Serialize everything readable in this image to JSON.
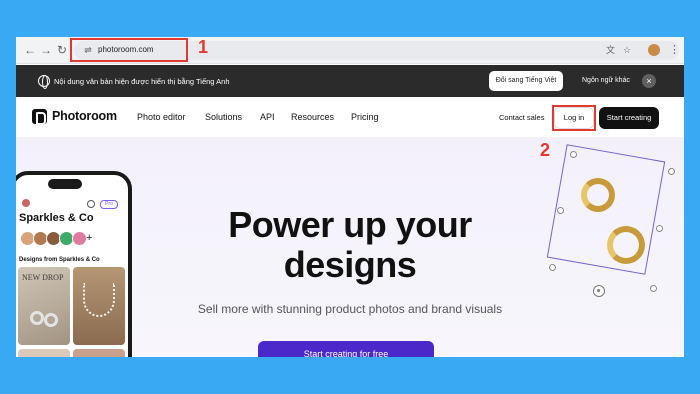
{
  "browser": {
    "url": "photoroom.com",
    "back_icon": "←",
    "forward_icon": "→",
    "reload_icon": "↻",
    "site_info_icon": "⇌",
    "translate_icon": "文",
    "bookmark_icon": "☆",
    "menu_icon": "⋮"
  },
  "translate_bar": {
    "message": "Nội dung văn bản hiện được hiển thị bằng Tiếng Anh",
    "switch_button": "Đổi sang Tiếng Việt",
    "other_languages": "Ngôn ngữ khác",
    "close_icon": "×"
  },
  "site_nav": {
    "logo": "Photoroom",
    "links": [
      "Photo editor",
      "Solutions",
      "API",
      "Resources",
      "Pricing"
    ],
    "contact_sales": "Contact sales",
    "log_in": "Log in",
    "start_creating": "Start creating"
  },
  "hero": {
    "title_line1": "Power up your",
    "title_line2": "designs",
    "subtitle": "Sell more with stunning product photos and brand visuals",
    "cta": "Start creating for free"
  },
  "phone": {
    "brand": "Sparkles & Co",
    "pro_badge": "Pro",
    "designs_label": "Designs from Sparkles & Co",
    "tile_text": "NEW DROP",
    "plus": "+"
  },
  "annotations": {
    "step1": "1",
    "step2": "2"
  },
  "colors": {
    "background": "#3aa9f3",
    "cta": "#4b28c9",
    "annotation_red": "#e0392f",
    "translate_bar": "#2b2b2b"
  }
}
